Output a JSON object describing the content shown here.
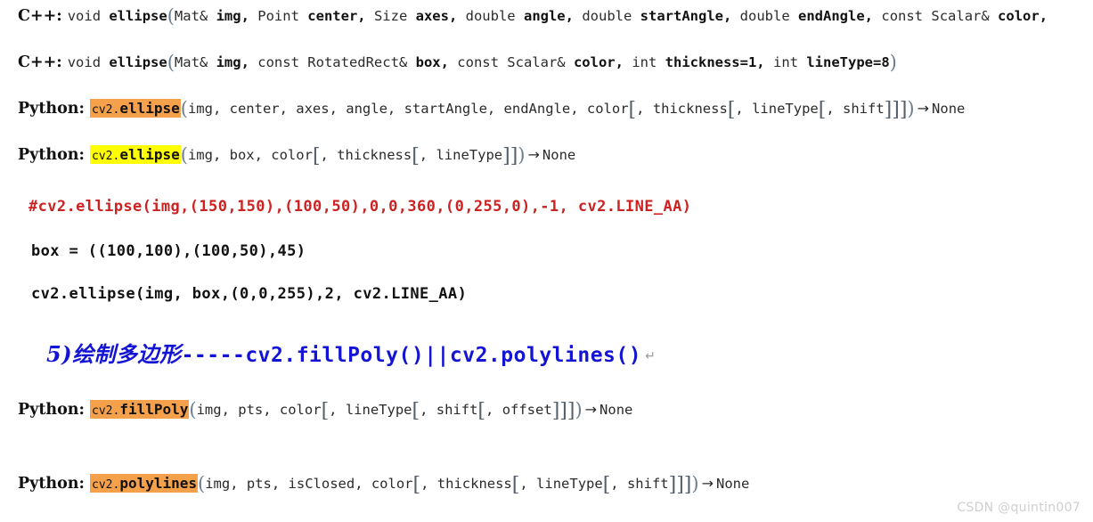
{
  "doc": {
    "background_color": "#ffffff",
    "text_color": "#1f1f1f"
  },
  "colors": {
    "highlight_orange": "#f5a14b",
    "highlight_yellow": "#ffff00",
    "comment_red": "#cc2222",
    "heading_blue": "#1414d4",
    "watermark_gray": "#cfcfcf",
    "bracket_gray": "#55606b"
  },
  "signatures": [
    {
      "lang_label": "C++:",
      "return_type": "void",
      "function": "ellipse",
      "open_paren": "(",
      "params": "Mat& img, Point center, Size axes, double angle, double startAngle, double endAngle, const Scalar& color,",
      "param_tokens": [
        {
          "t": "Mat&",
          "b": false
        },
        {
          "t": "img,",
          "b": true
        },
        {
          "t": "Point",
          "b": false
        },
        {
          "t": "center,",
          "b": true
        },
        {
          "t": "Size",
          "b": false
        },
        {
          "t": "axes,",
          "b": true
        },
        {
          "t": "double",
          "b": false
        },
        {
          "t": "angle,",
          "b": true
        },
        {
          "t": "double",
          "b": false
        },
        {
          "t": "startAngle,",
          "b": true
        },
        {
          "t": "double",
          "b": false
        },
        {
          "t": "endAngle,",
          "b": true
        },
        {
          "t": "const",
          "b": false
        },
        {
          "t": "Scalar&",
          "b": false
        },
        {
          "t": "color,",
          "b": true
        }
      ]
    },
    {
      "lang_label": "C++:",
      "return_type": "void",
      "function": "ellipse",
      "open_paren": "(",
      "close_paren": ")",
      "param_tokens": [
        {
          "t": "Mat&",
          "b": false
        },
        {
          "t": "img,",
          "b": true
        },
        {
          "t": "const",
          "b": false
        },
        {
          "t": "RotatedRect&",
          "b": false
        },
        {
          "t": "box,",
          "b": true
        },
        {
          "t": "const",
          "b": false
        },
        {
          "t": "Scalar&",
          "b": false
        },
        {
          "t": "color,",
          "b": true
        },
        {
          "t": "int",
          "b": false
        },
        {
          "t": "thickness=1,",
          "b": true
        },
        {
          "t": "int",
          "b": false
        },
        {
          "t": "lineType=8",
          "b": true
        }
      ]
    }
  ],
  "python_lines": [
    {
      "lang_label": "Python:",
      "module": "cv2.",
      "function": "ellipse",
      "highlight": "orange",
      "args_plain": "img, center, axes, angle, startAngle, endAngle, color",
      "optional": [
        "thickness",
        "lineType",
        "shift"
      ],
      "arrow": "→",
      "returns": "None"
    },
    {
      "lang_label": "Python:",
      "module": "cv2.",
      "function": "ellipse",
      "highlight": "yellow",
      "args_plain": "img, box, color",
      "optional": [
        "thickness",
        "lineType"
      ],
      "arrow": "→",
      "returns": "None"
    },
    {
      "lang_label": "Python:",
      "module": "cv2.",
      "function": "fillPoly",
      "highlight": "orange",
      "args_plain": "img, pts, color",
      "optional": [
        "lineType",
        "shift",
        "offset"
      ],
      "arrow": "→",
      "returns": "None"
    },
    {
      "lang_label": "Python:",
      "module": "cv2.",
      "function": "polylines",
      "highlight": "orange",
      "args_plain": "img, pts, isClosed, color",
      "optional": [
        "thickness",
        "lineType",
        "shift"
      ],
      "arrow": "→",
      "returns": "None"
    }
  ],
  "code_block": {
    "lines": [
      {
        "text": "#cv2.ellipse(img,(150,150),(100,50),0,0,360,(0,255,0),-1, cv2.LINE_AA)",
        "kind": "comment"
      },
      {
        "text": "box = ((100,100),(100,50),45)",
        "kind": "code"
      },
      {
        "text": "cv2.ellipse(img, box,(0,0,255),2, cv2.LINE_AA)",
        "kind": "code"
      }
    ]
  },
  "heading": {
    "number": "5)",
    "chinese": "绘制多边形",
    "dashes": "-----",
    "api_1": "cv2.fillPoly()",
    "separator": "||",
    "api_2": "cv2.polylines()",
    "pilcrow": "↵"
  },
  "watermark": {
    "text": "CSDN @quintin007"
  }
}
